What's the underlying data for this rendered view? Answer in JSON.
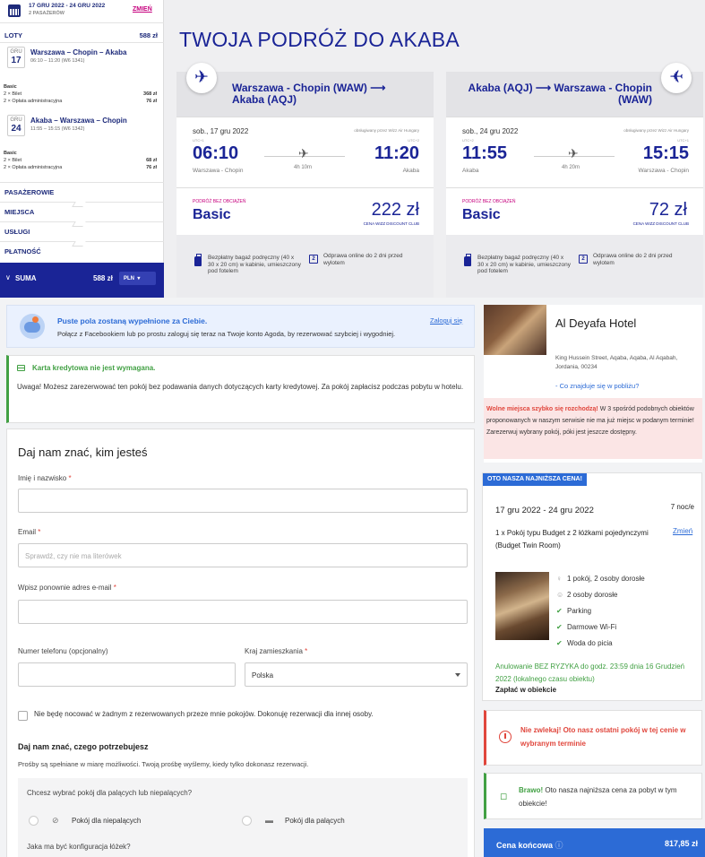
{
  "flight": {
    "dates": "17 GRU 2022 - 24 GRU 2022",
    "passengers": "2 PASAŻERÓW",
    "change": "ZMIEŃ",
    "flights_label": "LOTY",
    "flights_total": "588 zł",
    "legs": [
      {
        "month": "GRU",
        "day": "17",
        "route": "Warszawa – Chopin – Akaba",
        "time": "06:10 – 11:20 (W6 1341)",
        "fare": "Basic",
        "l1": "2 × Bilet",
        "v1": "368 zł",
        "l2": "2 × Opłata administracyjna",
        "v2": "76 zł"
      },
      {
        "month": "GRU",
        "day": "24",
        "route": "Akaba – Warszawa – Chopin",
        "time": "11:55 – 15:15 (W6 1342)",
        "fare": "Basic",
        "l1": "2 × Bilet",
        "v1": "68 zł",
        "l2": "2 × Opłata administracyjna",
        "v2": "76 zł"
      }
    ],
    "sections": [
      "PASAŻEROWIE",
      "MIEJSCA",
      "USŁUGI",
      "PŁATNOŚĆ"
    ],
    "sum_label": "SUMA",
    "sum_value": "588 zł",
    "currency": "PLN",
    "title": "TWOJA PODRÓŻ DO AKABA",
    "cards": [
      {
        "route": "Warszawa - Chopin (WAW) ⟶ Akaba (AQJ)",
        "date": "sob., 17 gru 2022",
        "operated": "obsługiwany przez Wizz Air Hungary",
        "utc_dep": "UTC+1",
        "utc_arr": "UTC+2",
        "dep": "06:10",
        "arr": "11:20",
        "duration": "4h 10m",
        "from": "Warszawa - Chopin",
        "to": "Akaba",
        "fare_tag": "PODRÓŻ BEZ OBCIĄŻEŃ",
        "fare": "Basic",
        "price": "222 zł",
        "club": "CENA WIZZ DISCOUNT CLUB",
        "bag": "Bezpłatny bagaż podręczny (40 x 30 x 20 cm) w kabinie, umieszczony pod fotelem",
        "checkin": "Odprawa online do 2 dni przed wylotem",
        "checkin_icon": "2"
      },
      {
        "route": "Akaba (AQJ) ⟶ Warszawa - Chopin (WAW)",
        "date": "sob., 24 gru 2022",
        "operated": "obsługiwany przez Wizz Air Hungary",
        "utc_dep": "UTC+2",
        "utc_arr": "UTC+1",
        "dep": "11:55",
        "arr": "15:15",
        "duration": "4h 20m",
        "from": "Akaba",
        "to": "Warszawa - Chopin",
        "fare_tag": "PODRÓŻ BEZ OBCIĄŻEŃ",
        "fare": "Basic",
        "price": "72 zł",
        "club": "CENA WIZZ DISCOUNT CLUB",
        "bag": "Bezpłatny bagaż podręczny (40 x 30 x 20 cm) w kabinie, umieszczony pod fotelem",
        "checkin": "Odprawa online do 2 dni przed wylotem",
        "checkin_icon": "2"
      }
    ],
    "plane_glyph": "✈"
  },
  "agoda": {
    "fb_title": "Puste pola zostaną wypełnione za Ciebie.",
    "fb_text": "Połącz z Facebookiem lub po prostu zaloguj się teraz na Twoje konto Agoda, by rezerwować szybciej i wygodniej.",
    "fb_login": "Zaloguj się",
    "cc_title": "Karta kredytowa nie jest wymagana.",
    "cc_text": "Uwaga! Możesz zarezerwować ten pokój bez podawania danych dotyczących karty kredytowej. Za pokój zapłacisz podczas pobytu w hotelu.",
    "form": {
      "heading": "Daj nam znać, kim jesteś",
      "name_label": "Imię i nazwisko",
      "email_label": "Email",
      "email_placeholder": "Sprawdź, czy nie ma literówek",
      "email2_label": "Wpisz ponownie adres e-mail",
      "phone_label": "Numer telefonu (opcjonalny)",
      "country_label": "Kraj zamieszkania",
      "country_value": "Polska",
      "required_mark": "*",
      "nonresident": "Nie będę nocować w żadnym z rezerwowanych przeze mnie pokojów. Dokonuję rezerwacji dla innej osoby.",
      "needs_heading": "Daj nam znać, czego potrzebujesz",
      "needs_text": "Prośby są spełniane w miarę możliwości. Twoją prośbę wyślemy, kiedy tylko dokonasz rezerwacji.",
      "smoke_q": "Chcesz wybrać pokój dla palących lub niepalących?",
      "nonsmoking": "Pokój dla niepalących",
      "smoking": "Pokój dla palących",
      "bed_q": "Jaka ma być konfiguracja łóżek?"
    },
    "hotel": {
      "name": "Al Deyafa Hotel",
      "address": "King Hussein Street, Aqaba, Aqaba, Al Aqabah, Jordania, 00234",
      "nearby": "- Co znajduje się w pobliżu?",
      "alert_bold": "Wolne miejsca szybko się rozchodzą!",
      "alert_text": " W 3 spośród podobnych obiektów proponowanych w naszym serwisie nie ma już miejsc w podanym terminie! Zarezerwuj wybrany pokój, póki jest jeszcze dostępny."
    },
    "price": {
      "badge": "OTO NASZA NAJNIŻSZA CENA!",
      "dates": "17 gru 2022 - 24 gru 2022",
      "nights": "7 noc/e",
      "room": "1 x Pokój typu Budget z 2 łóżkami pojedynczymi (Budget Twin Room)",
      "change": "Zmień",
      "features": [
        "1 pokój, 2 osoby dorosłe",
        "2 osoby dorosłe",
        "Parking",
        "Darmowe Wi-Fi",
        "Woda do picia"
      ],
      "cancel": "Anulowanie BEZ RYZYKA do godz. 23:59 dnia 16 Grudzień 2022 (lokalnego czasu obiektu)",
      "pay": "Zapłać w obiekcie"
    },
    "urgent": "Nie zwlekaj! Oto nasz ostatni pokój w tej cenie w wybranym terminie",
    "bravo_bold": "Brawo!",
    "bravo_text": " Oto nasza najniższa cena za pobyt w tym obiekcie!",
    "final_label": "Cena końcowa",
    "final_value": "817,85 zł"
  },
  "colors": {
    "wizz_navy": "#1a2496",
    "wizz_pink": "#c6007e",
    "agoda_blue": "#2c6bd6",
    "green": "#41a043",
    "red": "#e0463c"
  }
}
